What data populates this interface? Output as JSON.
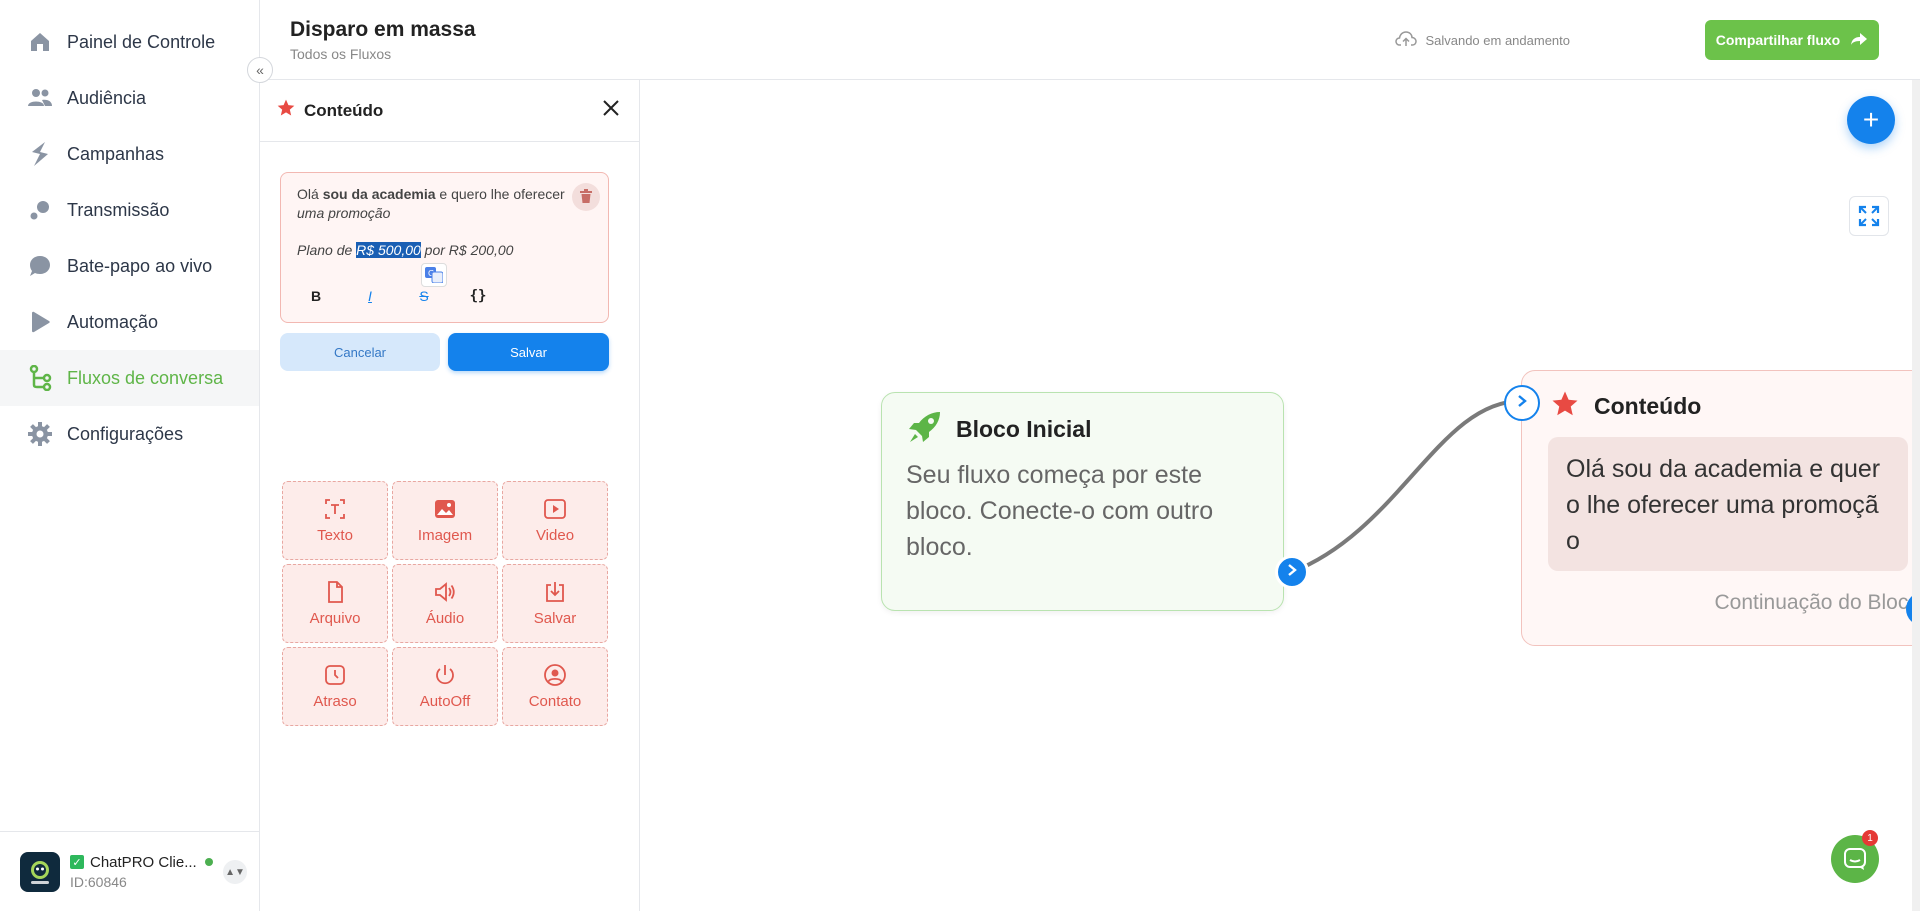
{
  "sidebar": {
    "items": [
      {
        "label": "Painel de Controle",
        "icon": "home-icon"
      },
      {
        "label": "Audiência",
        "icon": "users-icon"
      },
      {
        "label": "Campanhas",
        "icon": "bolt-icon"
      },
      {
        "label": "Transmissão",
        "icon": "broadcast-icon"
      },
      {
        "label": "Bate-papo ao vivo",
        "icon": "chat-bubble-icon"
      },
      {
        "label": "Automação",
        "icon": "play-icon"
      },
      {
        "label": "Fluxos de conversa",
        "icon": "flow-icon"
      },
      {
        "label": "Configurações",
        "icon": "gear-icon"
      }
    ],
    "active_item": "Fluxos de conversa",
    "account": {
      "name": "ChatPRO Clie...",
      "id": "ID:60846",
      "logo_text": "ChatPRO"
    }
  },
  "header": {
    "title": "Disparo em massa",
    "breadcrumb": "Todos os Fluxos",
    "save_status": "Salvando em andamento",
    "share_label": "Compartilhar fluxo"
  },
  "panel": {
    "title": "Conteúdo",
    "editor": {
      "line1_prefix": "Olá ",
      "line1_bold": "sou da academia",
      "line1_suffix": " e quero lhe oferecer",
      "line1_italic": "uma promoção",
      "line2_prefix": "Plano de ",
      "line2_selected": "R$ 500,00",
      "line2_suffix": " por R$ 200,00"
    },
    "toolbar": {
      "bold": "B",
      "italic": "I",
      "strike": "S",
      "variables": "{}"
    },
    "cancel_label": "Cancelar",
    "save_label": "Salvar",
    "blocks": [
      {
        "label": "Texto",
        "icon": "text-icon"
      },
      {
        "label": "Imagem",
        "icon": "image-icon"
      },
      {
        "label": "Video",
        "icon": "video-icon"
      },
      {
        "label": "Arquivo",
        "icon": "file-icon"
      },
      {
        "label": "Áudio",
        "icon": "audio-icon"
      },
      {
        "label": "Salvar",
        "icon": "download-icon"
      },
      {
        "label": "Atraso",
        "icon": "clock-icon"
      },
      {
        "label": "AutoOff",
        "icon": "power-icon"
      },
      {
        "label": "Contato",
        "icon": "contact-icon"
      }
    ]
  },
  "canvas": {
    "start_node": {
      "title": "Bloco Inicial",
      "description": "Seu fluxo começa por este bloco. Conecte-o com outro bloco."
    },
    "content_node": {
      "title": "Conteúdo",
      "message": "Olá sou da academia e quero lhe oferecer uma promoção",
      "continuation": "Continuação do Bloco"
    },
    "chat_badge": "1"
  },
  "colors": {
    "accent_green": "#6cc24a",
    "primary_blue": "#1482ec",
    "danger_red": "#e0584e"
  }
}
